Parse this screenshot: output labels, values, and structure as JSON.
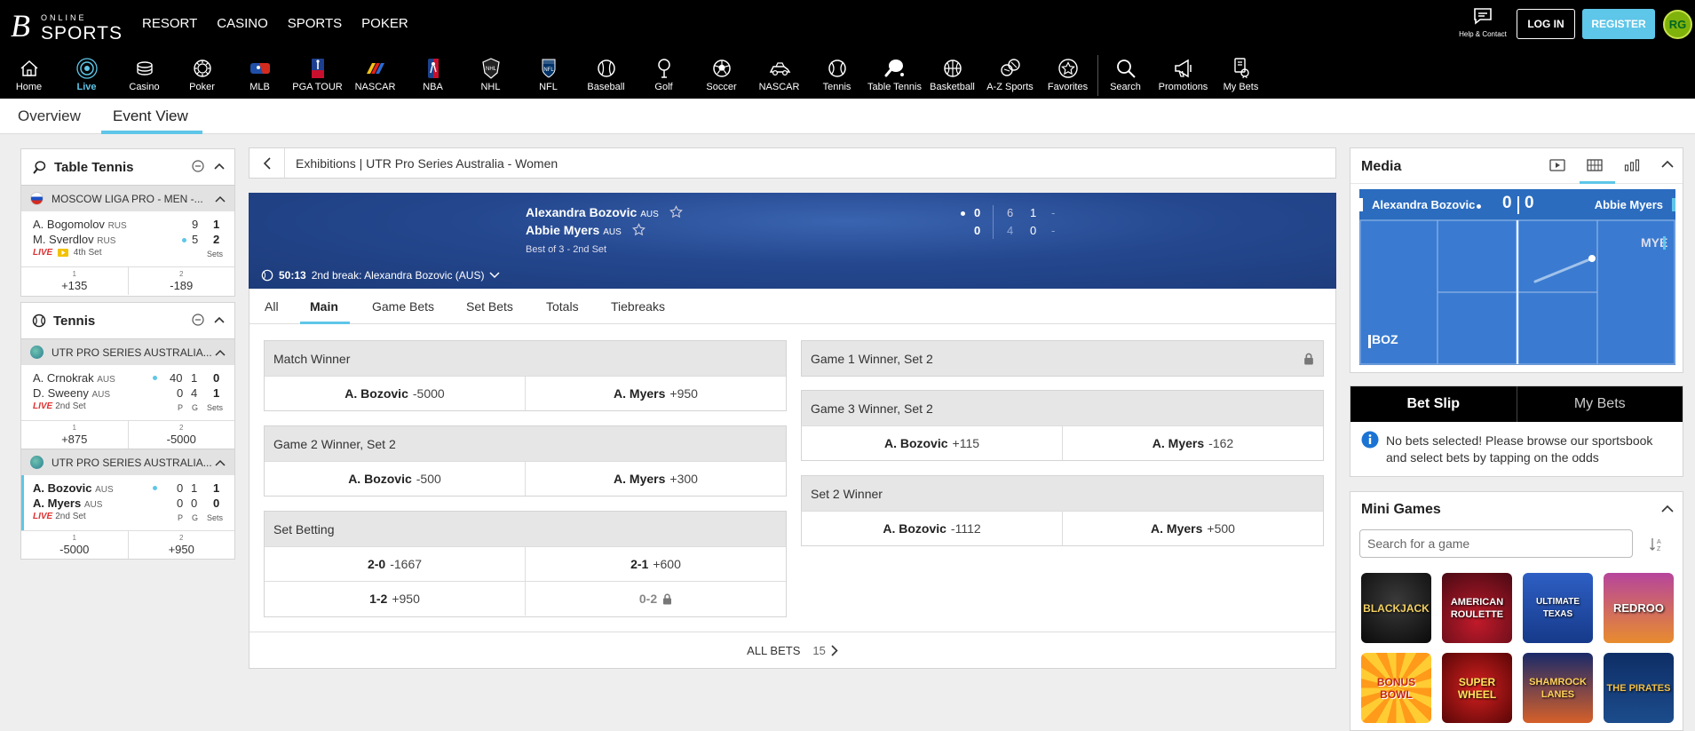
{
  "brand": {
    "logo_mark": "B",
    "logo_top": "ONLINE",
    "logo_main": "SPORTS"
  },
  "top_nav": [
    "RESORT",
    "CASINO",
    "SPORTS",
    "POKER"
  ],
  "header": {
    "help_label": "Help & Contact",
    "login": "LOG IN",
    "register": "REGISTER",
    "rg_badge": "RG"
  },
  "sport_nav": [
    {
      "label": "Home",
      "icon": "home-icon"
    },
    {
      "label": "Live",
      "icon": "live-icon",
      "active": true
    },
    {
      "label": "Casino",
      "icon": "casino-chips-icon"
    },
    {
      "label": "Poker",
      "icon": "poker-chip-icon"
    },
    {
      "label": "MLB",
      "icon": "mlb-logo-icon"
    },
    {
      "label": "PGA TOUR",
      "icon": "pga-tour-logo-icon"
    },
    {
      "label": "NASCAR",
      "icon": "nascar-logo-icon"
    },
    {
      "label": "NBA",
      "icon": "nba-logo-icon"
    },
    {
      "label": "NHL",
      "icon": "nhl-logo-icon"
    },
    {
      "label": "NFL",
      "icon": "nfl-logo-icon"
    },
    {
      "label": "Baseball",
      "icon": "baseball-icon"
    },
    {
      "label": "Golf",
      "icon": "golf-icon"
    },
    {
      "label": "Soccer",
      "icon": "soccer-ball-icon"
    },
    {
      "label": "NASCAR",
      "icon": "racing-car-icon"
    },
    {
      "label": "Tennis",
      "icon": "tennis-ball-icon"
    },
    {
      "label": "Table Tennis",
      "icon": "table-tennis-icon"
    },
    {
      "label": "Basketball",
      "icon": "basketball-icon"
    },
    {
      "label": "A-Z Sports",
      "icon": "az-sports-icon"
    },
    {
      "label": "Favorites",
      "icon": "star-icon"
    },
    {
      "label": "Search",
      "icon": "search-icon"
    },
    {
      "label": "Promotions",
      "icon": "megaphone-icon"
    },
    {
      "label": "My Bets",
      "icon": "my-bets-icon"
    }
  ],
  "view_tabs": {
    "overview": "Overview",
    "event_view": "Event View"
  },
  "sidebar": {
    "table_tennis": {
      "title": "Table Tennis",
      "league": "MOSCOW LIGA PRO - MEN -...",
      "match": {
        "p1": "A. Bogomolov",
        "p1_country": "RUS",
        "p1_score": "9",
        "p1_total": "1",
        "p2": "M. Sverdlov",
        "p2_country": "RUS",
        "p2_score": "5",
        "p2_total": "2",
        "live": "LIVE",
        "status": "4th Set",
        "sets_label": "Sets",
        "odds": [
          {
            "index": "1",
            "price": "+135"
          },
          {
            "index": "2",
            "price": "-189"
          }
        ]
      }
    },
    "tennis": {
      "title": "Tennis",
      "league1": "UTR PRO SERIES AUSTRALIA...",
      "match1": {
        "p1": "A. Crnokrak",
        "p1_country": "AUS",
        "p1_p": "40",
        "p1_g": "1",
        "p1_total": "0",
        "p2": "D. Sweeny",
        "p2_country": "AUS",
        "p2_p": "0",
        "p2_g": "4",
        "p2_total": "1",
        "live": "LIVE",
        "status": "2nd Set",
        "p_label": "P",
        "g_label": "G",
        "sets_label": "Sets",
        "odds": [
          {
            "index": "1",
            "price": "+875"
          },
          {
            "index": "2",
            "price": "-5000"
          }
        ]
      },
      "league2": "UTR PRO SERIES AUSTRALIA...",
      "match2": {
        "p1": "A. Bozovic",
        "p1_country": "AUS",
        "p1_p": "0",
        "p1_g": "1",
        "p1_total": "1",
        "p2": "A. Myers",
        "p2_country": "AUS",
        "p2_p": "0",
        "p2_g": "0",
        "p2_total": "0",
        "live": "LIVE",
        "status": "2nd Set",
        "p_label": "P",
        "g_label": "G",
        "sets_label": "Sets",
        "odds": [
          {
            "index": "1",
            "price": "-5000"
          },
          {
            "index": "2",
            "price": "+950"
          }
        ]
      }
    }
  },
  "event": {
    "breadcrumb": "Exhibitions | UTR Pro Series Australia - Women",
    "p1": "Alexandra Bozovic",
    "p1_country": "AUS",
    "p2": "Abbie Myers",
    "p2_country": "AUS",
    "format": "Best of 3 - 2nd Set",
    "p1_points": "0",
    "p1_set1": "6",
    "p1_set2": "1",
    "p1_set3": "-",
    "p2_points": "0",
    "p2_set1": "4",
    "p2_set2": "0",
    "p2_set3": "-",
    "clock": "50:13",
    "break_info": "2nd break: Alexandra Bozovic (AUS)"
  },
  "market_tabs": [
    "All",
    "Main",
    "Game Bets",
    "Set Bets",
    "Totals",
    "Tiebreaks"
  ],
  "markets": {
    "match_winner": {
      "title": "Match Winner",
      "o1_name": "A. Bozovic",
      "o1_price": "-5000",
      "o2_name": "A. Myers",
      "o2_price": "+950"
    },
    "game2_set2": {
      "title": "Game 2 Winner, Set 2",
      "o1_name": "A. Bozovic",
      "o1_price": "-500",
      "o2_name": "A. Myers",
      "o2_price": "+300"
    },
    "set_betting": {
      "title": "Set Betting",
      "o1_name": "2-0",
      "o1_price": "-1667",
      "o2_name": "2-1",
      "o2_price": "+600",
      "o3_name": "1-2",
      "o3_price": "+950",
      "o4_name": "0-2"
    },
    "game1_set2": {
      "title": "Game 1 Winner, Set 2"
    },
    "game3_set2": {
      "title": "Game 3 Winner, Set 2",
      "o1_name": "A. Bozovic",
      "o1_price": "+115",
      "o2_name": "A. Myers",
      "o2_price": "-162"
    },
    "set2_winner": {
      "title": "Set 2 Winner",
      "o1_name": "A. Bozovic",
      "o1_price": "-1112",
      "o2_name": "A. Myers",
      "o2_price": "+500"
    }
  },
  "all_bets": {
    "label": "ALL BETS",
    "count": "15"
  },
  "media": {
    "title": "Media",
    "p1": "Alexandra Bozovic",
    "p1_score": "0",
    "p2": "Abbie Myers",
    "p2_score": "0",
    "abbr1": "BOZ",
    "abbr2": "MYE"
  },
  "bet_slip": {
    "tab_active": "Bet Slip",
    "tab_other": "My Bets",
    "message": "No bets selected! Please browse our sportsbook and select bets by tapping on the odds"
  },
  "mini_games": {
    "title": "Mini Games",
    "search_placeholder": "Search for a game",
    "games": [
      "BLACKJACK",
      "AMERICAN ROULETTE",
      "ULTIMATE TEXAS",
      "REDROO",
      "BONUS BOWL",
      "SUPER WHEEL",
      "SHAMROCK LANES",
      "THE PIRATES"
    ]
  },
  "colors": {
    "accent": "#5ec6e8",
    "live": "#dd3333",
    "scoreboard": "#24478e",
    "court": "#2b6cbf"
  }
}
